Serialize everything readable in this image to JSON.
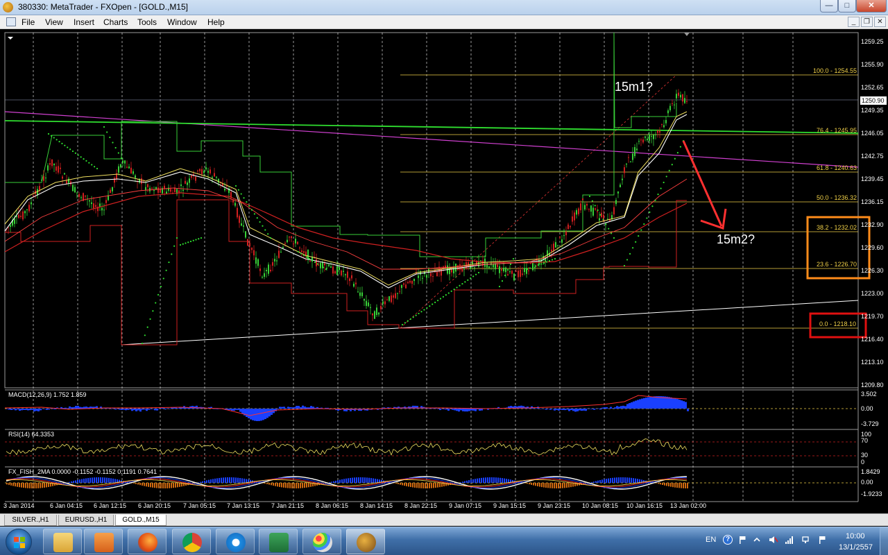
{
  "window": {
    "title": "380330: MetaTrader - FXOpen - [GOLD.,M15]",
    "minimize": "—",
    "maximize": "□",
    "close": "✕"
  },
  "menu": {
    "items": [
      "File",
      "View",
      "Insert",
      "Charts",
      "Tools",
      "Window",
      "Help"
    ]
  },
  "mdi_controls": {
    "minimize": "_",
    "restore": "❐",
    "close": "✕"
  },
  "chart": {
    "current_price": "1250.90",
    "price_axis": [
      "1259.25",
      "1255.90",
      "1252.65",
      "1249.35",
      "1246.05",
      "1242.75",
      "1239.45",
      "1236.15",
      "1232.90",
      "1229.60",
      "1226.30",
      "1223.00",
      "1219.70",
      "1216.40",
      "1213.10",
      "1209.80"
    ],
    "time_axis": [
      "3 Jan 2014",
      "6 Jan 04:15",
      "6 Jan 12:15",
      "6 Jan 20:15",
      "7 Jan 05:15",
      "7 Jan 13:15",
      "7 Jan 21:15",
      "8 Jan 06:15",
      "8 Jan 14:15",
      "8 Jan 22:15",
      "9 Jan 07:15",
      "9 Jan 15:15",
      "9 Jan 23:15",
      "10 Jan 08:15",
      "10 Jan 16:15",
      "13 Jan 02:00"
    ],
    "fib_levels": [
      "100.0 - 1254.55",
      "76.4 - 1245.95",
      "61.8 - 1240.63",
      "50.0 - 1236.32",
      "38.2 - 1232.02",
      "23.6 - 1226.70",
      "0.0 - 1218.10"
    ],
    "annotations": {
      "note1": "15m1?",
      "note2": "15m2?"
    },
    "macd": {
      "label": "MACD(12,26,9) 1.752 1.859",
      "axis": [
        "3.502",
        "0.00",
        "-3.729"
      ]
    },
    "rsi": {
      "label": "RSI(14) 64.3353",
      "axis": [
        "100",
        "70",
        "30",
        "0"
      ]
    },
    "fisher": {
      "label": "FX_FISH_2MA 0.0000 -0.1152 -0.1152 0.1191 0.7641",
      "axis": [
        "1.8429",
        "0.00",
        "-1.9233"
      ]
    }
  },
  "tabs": [
    "SILVER.,H1",
    "EURUSD.,H1",
    "GOLD.,M15"
  ],
  "taskbar": {
    "language": "EN",
    "time": "10:00",
    "date": "13/1/2557"
  },
  "colors": {
    "fib": "#f0d048",
    "bull": "#38d038",
    "bear": "#d02020",
    "orange_box": "#ff8c1a",
    "red_box": "#e01010"
  }
}
